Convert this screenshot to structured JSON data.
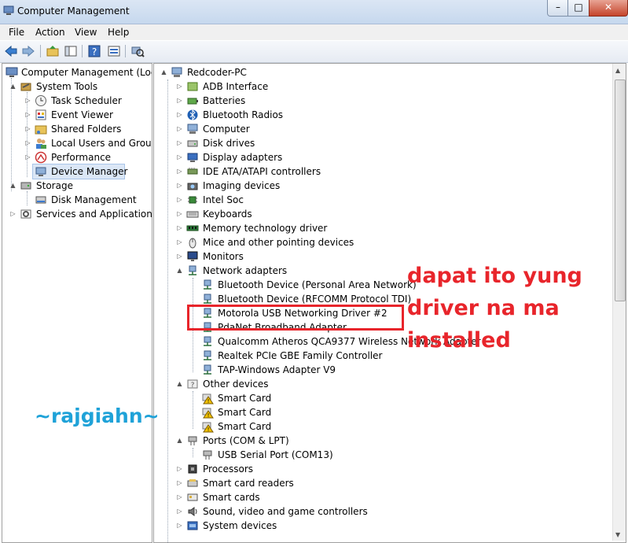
{
  "window": {
    "title": "Computer Management",
    "minimize": "–",
    "maximize": "□",
    "close": "✕"
  },
  "menu": [
    "File",
    "Action",
    "View",
    "Help"
  ],
  "toolbar": {
    "icons": [
      "back-arrow-icon",
      "forward-arrow-icon",
      "up-folder-icon",
      "show-hide-tree-icon",
      "help-icon",
      "properties-icon",
      "scan-hardware-icon"
    ]
  },
  "left_tree": [
    {
      "label": "Computer Management (Local",
      "icon": "computer-management-icon",
      "expand": "▲"
    },
    {
      "label": "System Tools",
      "icon": "system-tools-icon",
      "expand": "▲"
    },
    {
      "label": "Task Scheduler",
      "icon": "clock-icon",
      "expand": "▷"
    },
    {
      "label": "Event Viewer",
      "icon": "event-viewer-icon",
      "expand": "▷"
    },
    {
      "label": "Shared Folders",
      "icon": "shared-folder-icon",
      "expand": "▷"
    },
    {
      "label": "Local Users and Groups",
      "icon": "users-icon",
      "expand": "▷"
    },
    {
      "label": "Performance",
      "icon": "performance-icon",
      "expand": "▷"
    },
    {
      "label": "Device Manager",
      "icon": "device-manager-icon",
      "expand": ""
    },
    {
      "label": "Storage",
      "icon": "storage-icon",
      "expand": "▲"
    },
    {
      "label": "Disk Management",
      "icon": "disk-icon",
      "expand": ""
    },
    {
      "label": "Services and Applications",
      "icon": "services-icon",
      "expand": "▷"
    }
  ],
  "device_tree": [
    {
      "label": "Redcoder-PC",
      "icon": "computer-icon",
      "expand": "▲"
    },
    {
      "label": "ADB Interface",
      "icon": "adb-icon",
      "expand": "▷"
    },
    {
      "label": "Batteries",
      "icon": "battery-icon",
      "expand": "▷"
    },
    {
      "label": "Bluetooth Radios",
      "icon": "bluetooth-icon",
      "expand": "▷"
    },
    {
      "label": "Computer",
      "icon": "computer-icon",
      "expand": "▷"
    },
    {
      "label": "Disk drives",
      "icon": "disk-drive-icon",
      "expand": "▷"
    },
    {
      "label": "Display adapters",
      "icon": "display-adapter-icon",
      "expand": "▷"
    },
    {
      "label": "IDE ATA/ATAPI controllers",
      "icon": "ide-controller-icon",
      "expand": "▷"
    },
    {
      "label": "Imaging devices",
      "icon": "camera-icon",
      "expand": "▷"
    },
    {
      "label": "Intel Soc",
      "icon": "chip-icon",
      "expand": "▷"
    },
    {
      "label": "Keyboards",
      "icon": "keyboard-icon",
      "expand": "▷"
    },
    {
      "label": "Memory technology driver",
      "icon": "memory-icon",
      "expand": "▷"
    },
    {
      "label": "Mice and other pointing devices",
      "icon": "mouse-icon",
      "expand": "▷"
    },
    {
      "label": "Monitors",
      "icon": "monitor-icon",
      "expand": "▷"
    },
    {
      "label": "Network adapters",
      "icon": "network-adapter-icon",
      "expand": "▲"
    },
    {
      "label": "Bluetooth Device (Personal Area Network)",
      "icon": "network-adapter-icon",
      "expand": ""
    },
    {
      "label": "Bluetooth Device (RFCOMM Protocol TDI)",
      "icon": "network-adapter-icon",
      "expand": ""
    },
    {
      "label": "Motorola USB Networking Driver #2",
      "icon": "network-adapter-icon",
      "expand": ""
    },
    {
      "label": "PdaNet Broadband Adapter",
      "icon": "network-adapter-icon",
      "expand": ""
    },
    {
      "label": "Qualcomm Atheros QCA9377 Wireless Network Adapter",
      "icon": "network-adapter-icon",
      "expand": ""
    },
    {
      "label": "Realtek PCIe GBE Family Controller",
      "icon": "network-adapter-icon",
      "expand": ""
    },
    {
      "label": "TAP-Windows Adapter V9",
      "icon": "network-adapter-icon",
      "expand": ""
    },
    {
      "label": "Other devices",
      "icon": "unknown-device-icon",
      "expand": "▲"
    },
    {
      "label": "Smart Card",
      "icon": "warning-device-icon",
      "expand": ""
    },
    {
      "label": "Smart Card",
      "icon": "warning-device-icon",
      "expand": ""
    },
    {
      "label": "Smart Card",
      "icon": "warning-device-icon",
      "expand": ""
    },
    {
      "label": "Ports (COM & LPT)",
      "icon": "port-icon",
      "expand": "▲"
    },
    {
      "label": "USB Serial Port (COM13)",
      "icon": "port-icon",
      "expand": ""
    },
    {
      "label": "Processors",
      "icon": "processor-icon",
      "expand": "▷"
    },
    {
      "label": "Smart card readers",
      "icon": "card-reader-icon",
      "expand": "▷"
    },
    {
      "label": "Smart cards",
      "icon": "smart-card-icon",
      "expand": "▷"
    },
    {
      "label": "Sound, video and game controllers",
      "icon": "sound-icon",
      "expand": "▷"
    },
    {
      "label": "System devices",
      "icon": "system-device-icon",
      "expand": "▷"
    }
  ],
  "annotation": {
    "line1": "dapat ito yung",
    "line2": "driver na ma",
    "line3": "installed",
    "color": "#e8252b"
  },
  "watermark": {
    "text": "~rajgiahn~",
    "color": "#1fa2d8"
  }
}
